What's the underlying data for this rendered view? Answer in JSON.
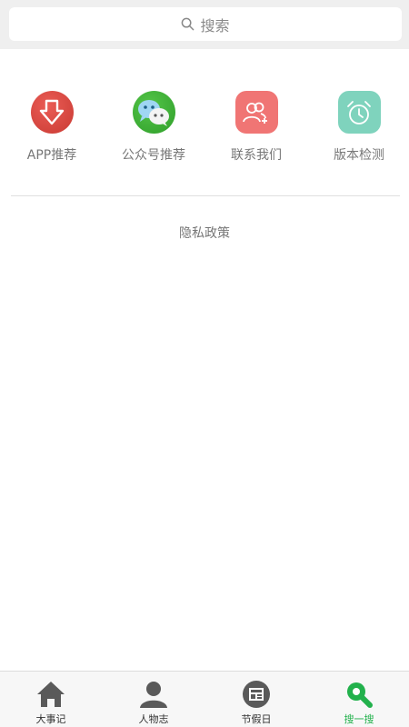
{
  "search": {
    "placeholder": "搜索"
  },
  "features": [
    {
      "label": "APP推荐",
      "icon": "download-icon",
      "color": "#d9473f"
    },
    {
      "label": "公众号推荐",
      "icon": "wechat-icon",
      "color": "#3cb034"
    },
    {
      "label": "联系我们",
      "icon": "add-contact-icon",
      "color": "#f07574"
    },
    {
      "label": "版本检测",
      "icon": "alarm-clock-icon",
      "color": "#7fd3bd"
    }
  ],
  "privacy": {
    "label": "隐私政策"
  },
  "tabbar": {
    "items": [
      {
        "label": "大事记",
        "icon": "home-icon"
      },
      {
        "label": "人物志",
        "icon": "person-icon"
      },
      {
        "label": "节假日",
        "icon": "calendar-icon"
      },
      {
        "label": "搜一搜",
        "icon": "search-icon",
        "active": true
      }
    ],
    "active_color": "#22b14c",
    "inactive_color": "#5a5a5a"
  }
}
